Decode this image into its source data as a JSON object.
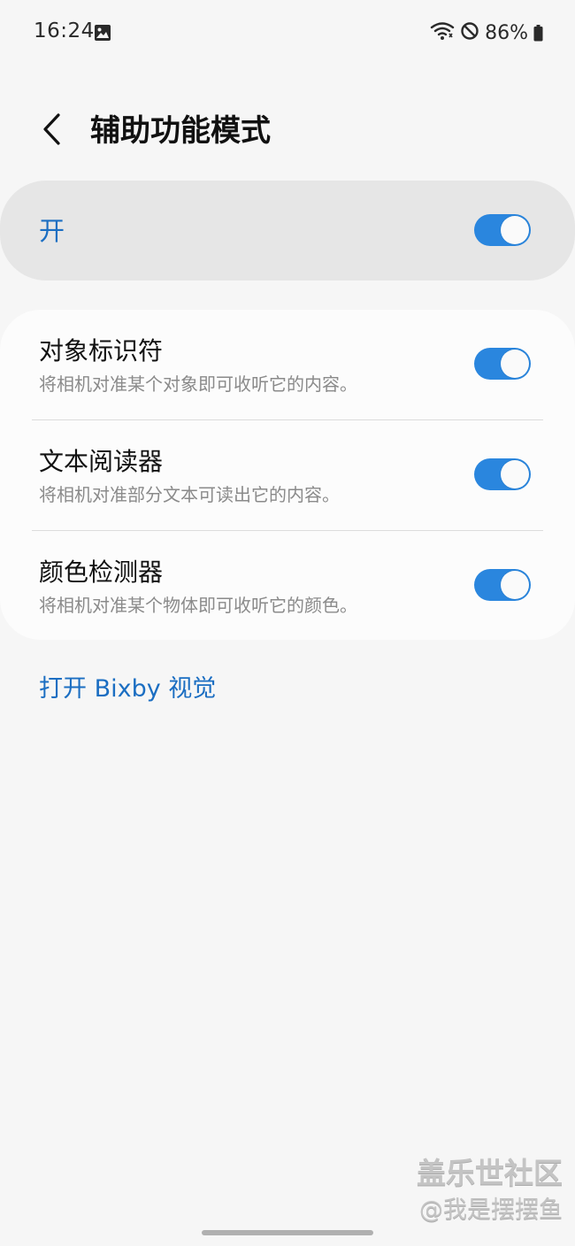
{
  "status_bar": {
    "time": "16:24",
    "battery_percent": "86%",
    "icons": [
      "gallery-icon",
      "wifi-icon",
      "do-not-disturb-icon",
      "battery-icon"
    ]
  },
  "header": {
    "back_icon": "chevron-left-icon",
    "title": "辅助功能模式"
  },
  "master_switch": {
    "label": "开",
    "enabled": true
  },
  "features": [
    {
      "title": "对象标识符",
      "description": "将相机对准某个对象即可收听它的内容。",
      "enabled": true
    },
    {
      "title": "文本阅读器",
      "description": "将相机对准部分文本可读出它的内容。",
      "enabled": true
    },
    {
      "title": "颜色检测器",
      "description": "将相机对准某个物体即可收听它的颜色。",
      "enabled": true
    }
  ],
  "bixby_link": "打开 Bixby 视觉",
  "watermark": {
    "title": "盖乐世社区",
    "author": "@我是摆摆鱼"
  },
  "colors": {
    "accent": "#1b6ec2",
    "toggle_on": "#2a86de",
    "background": "#f6f6f6",
    "card": "#fcfcfc",
    "master_card": "#e6e6e6"
  }
}
